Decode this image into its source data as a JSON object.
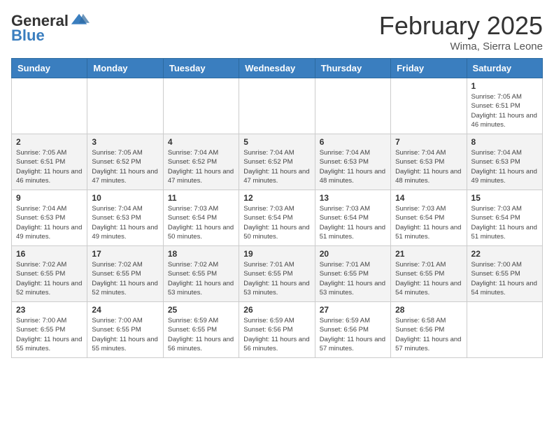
{
  "header": {
    "logo_general": "General",
    "logo_blue": "Blue",
    "month_title": "February 2025",
    "location": "Wima, Sierra Leone"
  },
  "days_of_week": [
    "Sunday",
    "Monday",
    "Tuesday",
    "Wednesday",
    "Thursday",
    "Friday",
    "Saturday"
  ],
  "weeks": [
    [
      {
        "day": "",
        "info": ""
      },
      {
        "day": "",
        "info": ""
      },
      {
        "day": "",
        "info": ""
      },
      {
        "day": "",
        "info": ""
      },
      {
        "day": "",
        "info": ""
      },
      {
        "day": "",
        "info": ""
      },
      {
        "day": "1",
        "info": "Sunrise: 7:05 AM\nSunset: 6:51 PM\nDaylight: 11 hours and 46 minutes."
      }
    ],
    [
      {
        "day": "2",
        "info": "Sunrise: 7:05 AM\nSunset: 6:51 PM\nDaylight: 11 hours and 46 minutes."
      },
      {
        "day": "3",
        "info": "Sunrise: 7:05 AM\nSunset: 6:52 PM\nDaylight: 11 hours and 47 minutes."
      },
      {
        "day": "4",
        "info": "Sunrise: 7:04 AM\nSunset: 6:52 PM\nDaylight: 11 hours and 47 minutes."
      },
      {
        "day": "5",
        "info": "Sunrise: 7:04 AM\nSunset: 6:52 PM\nDaylight: 11 hours and 47 minutes."
      },
      {
        "day": "6",
        "info": "Sunrise: 7:04 AM\nSunset: 6:53 PM\nDaylight: 11 hours and 48 minutes."
      },
      {
        "day": "7",
        "info": "Sunrise: 7:04 AM\nSunset: 6:53 PM\nDaylight: 11 hours and 48 minutes."
      },
      {
        "day": "8",
        "info": "Sunrise: 7:04 AM\nSunset: 6:53 PM\nDaylight: 11 hours and 49 minutes."
      }
    ],
    [
      {
        "day": "9",
        "info": "Sunrise: 7:04 AM\nSunset: 6:53 PM\nDaylight: 11 hours and 49 minutes."
      },
      {
        "day": "10",
        "info": "Sunrise: 7:04 AM\nSunset: 6:53 PM\nDaylight: 11 hours and 49 minutes."
      },
      {
        "day": "11",
        "info": "Sunrise: 7:03 AM\nSunset: 6:54 PM\nDaylight: 11 hours and 50 minutes."
      },
      {
        "day": "12",
        "info": "Sunrise: 7:03 AM\nSunset: 6:54 PM\nDaylight: 11 hours and 50 minutes."
      },
      {
        "day": "13",
        "info": "Sunrise: 7:03 AM\nSunset: 6:54 PM\nDaylight: 11 hours and 51 minutes."
      },
      {
        "day": "14",
        "info": "Sunrise: 7:03 AM\nSunset: 6:54 PM\nDaylight: 11 hours and 51 minutes."
      },
      {
        "day": "15",
        "info": "Sunrise: 7:03 AM\nSunset: 6:54 PM\nDaylight: 11 hours and 51 minutes."
      }
    ],
    [
      {
        "day": "16",
        "info": "Sunrise: 7:02 AM\nSunset: 6:55 PM\nDaylight: 11 hours and 52 minutes."
      },
      {
        "day": "17",
        "info": "Sunrise: 7:02 AM\nSunset: 6:55 PM\nDaylight: 11 hours and 52 minutes."
      },
      {
        "day": "18",
        "info": "Sunrise: 7:02 AM\nSunset: 6:55 PM\nDaylight: 11 hours and 53 minutes."
      },
      {
        "day": "19",
        "info": "Sunrise: 7:01 AM\nSunset: 6:55 PM\nDaylight: 11 hours and 53 minutes."
      },
      {
        "day": "20",
        "info": "Sunrise: 7:01 AM\nSunset: 6:55 PM\nDaylight: 11 hours and 53 minutes."
      },
      {
        "day": "21",
        "info": "Sunrise: 7:01 AM\nSunset: 6:55 PM\nDaylight: 11 hours and 54 minutes."
      },
      {
        "day": "22",
        "info": "Sunrise: 7:00 AM\nSunset: 6:55 PM\nDaylight: 11 hours and 54 minutes."
      }
    ],
    [
      {
        "day": "23",
        "info": "Sunrise: 7:00 AM\nSunset: 6:55 PM\nDaylight: 11 hours and 55 minutes."
      },
      {
        "day": "24",
        "info": "Sunrise: 7:00 AM\nSunset: 6:55 PM\nDaylight: 11 hours and 55 minutes."
      },
      {
        "day": "25",
        "info": "Sunrise: 6:59 AM\nSunset: 6:55 PM\nDaylight: 11 hours and 56 minutes."
      },
      {
        "day": "26",
        "info": "Sunrise: 6:59 AM\nSunset: 6:56 PM\nDaylight: 11 hours and 56 minutes."
      },
      {
        "day": "27",
        "info": "Sunrise: 6:59 AM\nSunset: 6:56 PM\nDaylight: 11 hours and 57 minutes."
      },
      {
        "day": "28",
        "info": "Sunrise: 6:58 AM\nSunset: 6:56 PM\nDaylight: 11 hours and 57 minutes."
      },
      {
        "day": "",
        "info": ""
      }
    ]
  ]
}
